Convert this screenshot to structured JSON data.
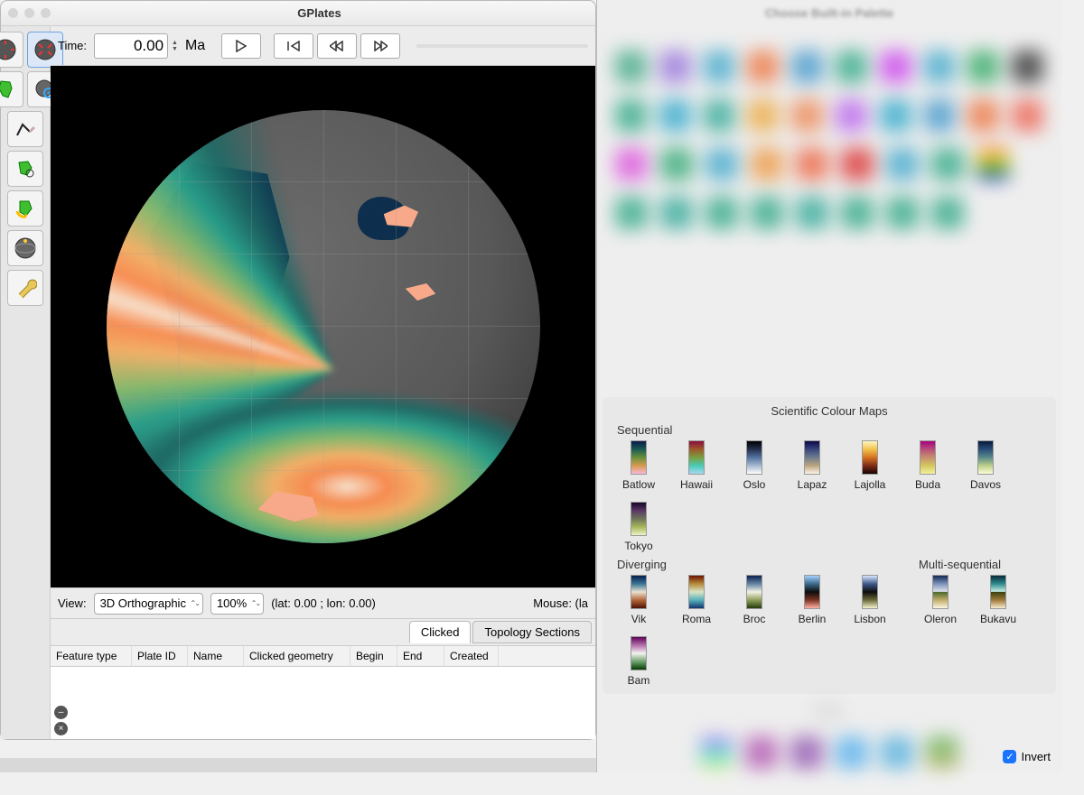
{
  "window": {
    "title": "GPlates"
  },
  "time": {
    "label": "Time:",
    "value": "0.00",
    "unit": "Ma"
  },
  "view": {
    "label": "View:",
    "projection": "3D Orthographic",
    "zoom": "100%",
    "latlon": "(lat: 0.00 ; lon: 0.00)",
    "mouse_label": "Mouse: (la"
  },
  "tabs": {
    "clicked": "Clicked",
    "topology": "Topology Sections"
  },
  "table": {
    "headers": [
      "Feature type",
      "Plate ID",
      "Name",
      "Clicked geometry",
      "Begin",
      "End",
      "Created"
    ]
  },
  "palette": {
    "title": "Choose Built-in Palette",
    "section_sci": "Scientific Colour Maps",
    "section_other": "Other",
    "group_seq": "Sequential",
    "group_div": "Diverging",
    "group_multi": "Multi-sequential",
    "invert": "Invert",
    "sequential": [
      {
        "name": "Batlow",
        "g": "linear-gradient(#0b1a4a,#1a5b54,#6a8f3c,#d59a4f,#f9b9d6)"
      },
      {
        "name": "Hawaii",
        "g": "linear-gradient(#8a0d3c,#9d5a2c,#7aa040,#48cbb4,#a7d8f3)"
      },
      {
        "name": "Oslo",
        "g": "linear-gradient(#000,#26304e,#5472a0,#a6b8d0,#fff)"
      },
      {
        "name": "Lapaz",
        "g": "linear-gradient(#0b0846,#3a477f,#6f7d8e,#bba47f,#fff3e6)"
      },
      {
        "name": "Lajolla",
        "g": "linear-gradient(#fff7c0,#f2c24b,#d47222,#7d2c18,#170300)"
      },
      {
        "name": "Buda",
        "g": "linear-gradient(#a6007f,#b94f7a,#c78f6e,#d3c75f,#f2f29c)"
      },
      {
        "name": "Davos",
        "g": "linear-gradient(#061a3a,#2a4d7a,#5a8a8a,#bccf88,#fcfdd6)"
      },
      {
        "name": "Tokyo",
        "g": "linear-gradient(#18052a,#5a3864,#6d7557,#a7b85a,#eef2c8)"
      }
    ],
    "diverging": [
      {
        "name": "Vik",
        "g": "linear-gradient(#061f4d,#3a7694,#e9e1cf,#b3663a,#4e1103)"
      },
      {
        "name": "Roma",
        "g": "linear-gradient(#6c1300,#b58c3a,#d9e4c6,#56b0bc,#11356f)"
      },
      {
        "name": "Broc",
        "g": "linear-gradient(#0a2250,#6384a3,#f1f0e4,#8ea05a,#253a0d)"
      },
      {
        "name": "Berlin",
        "g": "linear-gradient(#a4d0ff,#3d6a8a,#0d0d0d,#7a3423,#ffb0a0)"
      },
      {
        "name": "Lisbon",
        "g": "linear-gradient(#d8e6ff,#3d5a8a,#0d0d0d,#6b6a38,#f5f3cc)"
      },
      {
        "name": "Bam",
        "g": "linear-gradient(#5e0358,#b46fa8,#f2f2f2,#6ea36e,#063b06)"
      }
    ],
    "multiseq": [
      {
        "name": "Oleron",
        "g": "linear-gradient(#122a55,#7a90b8,#dfe3ec 49%,#4a6a2a 50%,#c2ad6c,#fdf7e0)"
      },
      {
        "name": "Bukavu",
        "g": "linear-gradient(#0a2a3a,#2a8a8a,#c7ede6 49%,#3a4010 50%,#a07a3a,#f8ead0)"
      }
    ]
  }
}
